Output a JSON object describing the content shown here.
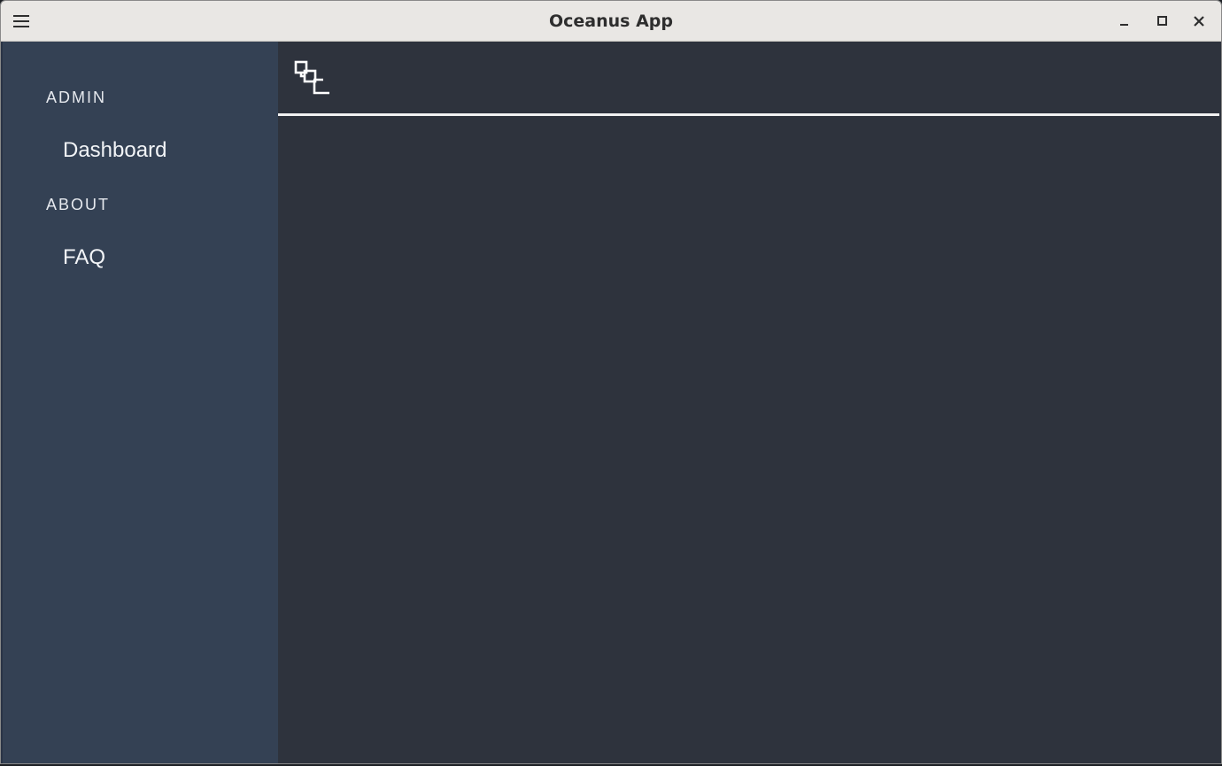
{
  "window": {
    "title": "Oceanus App",
    "controls": {
      "menu": "hamburger-menu-icon",
      "minimize": "minimize-icon",
      "maximize": "maximize-icon",
      "close": "close-icon"
    }
  },
  "sidebar": {
    "sections": [
      {
        "label": "ADMIN",
        "items": [
          {
            "label": "Dashboard"
          }
        ]
      },
      {
        "label": "ABOUT",
        "items": [
          {
            "label": "FAQ"
          }
        ]
      }
    ]
  },
  "main": {
    "toolbar_icon": "sitemap-icon"
  },
  "colors": {
    "titlebar": "#e9e7e4",
    "sidebar": "#344154",
    "content": "#2e333d",
    "text_light": "#f2f4f7"
  }
}
